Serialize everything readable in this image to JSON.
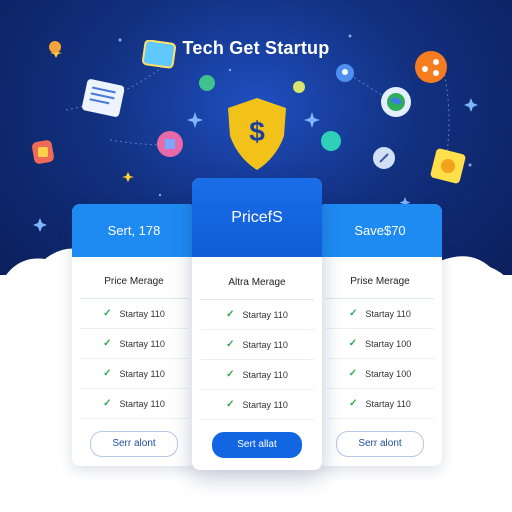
{
  "title": "Tech Get Startup",
  "plans": [
    {
      "header": "Sert, 178",
      "subtitle": "Price Merage",
      "features": [
        "Startay 110",
        "Startay 110",
        "Startay 110",
        "Startay 110"
      ],
      "button": "Serr alont"
    },
    {
      "header": "PricefS",
      "subtitle": "Altra Merage",
      "features": [
        "Startay 110",
        "Startay 110",
        "Startay 110",
        "Startay 110"
      ],
      "button": "Sert allat"
    },
    {
      "header": "Save$70",
      "subtitle": "Prise Merage",
      "features": [
        "Startay 110",
        "Startay 100",
        "Startay 100",
        "Startay 110"
      ],
      "button": "Serr alont"
    }
  ],
  "colors": {
    "hero_dark": "#0a1d57",
    "accent_blue": "#1366e2",
    "side_blue": "#1e8bf2",
    "check_green": "#2ea84f",
    "shield_yellow": "#f2c21b"
  },
  "icons": [
    "shield-dollar-icon",
    "document-icon",
    "chat-bubble-icon",
    "share-icon",
    "globe-icon",
    "location-pin-icon",
    "sparkle-icon"
  ]
}
